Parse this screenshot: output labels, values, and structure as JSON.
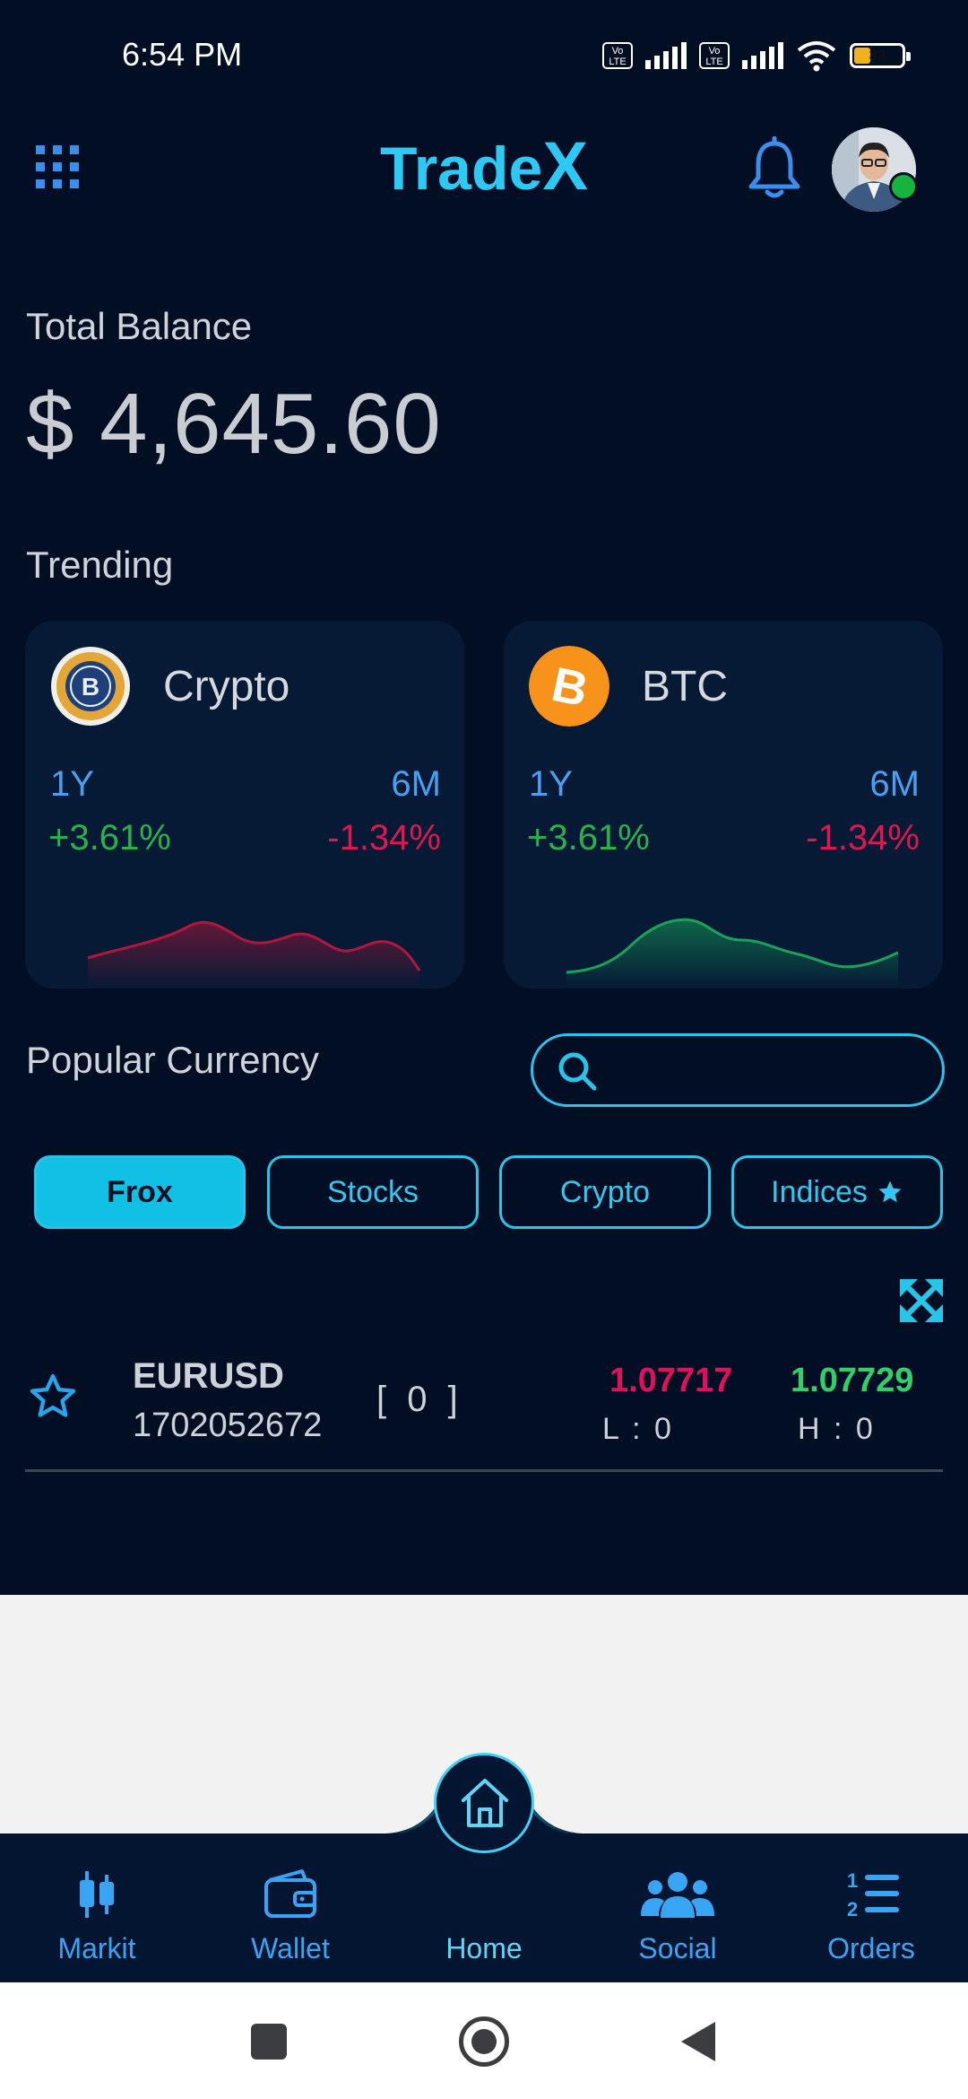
{
  "status_bar": {
    "time": "6:54 PM",
    "volte_label": "Vo LTE",
    "battery_level": "33"
  },
  "header": {
    "app_title_main": "Trade",
    "app_title_accent": "X"
  },
  "balance": {
    "label": "Total Balance",
    "value": "$ 4,645.60"
  },
  "trending": {
    "label": "Trending",
    "cards": [
      {
        "name": "Crypto",
        "icon": "bitcoin-gold-coin-icon",
        "period_1": "1Y",
        "period_2": "6M",
        "change_1": "+3.61%",
        "change_2": "-1.34%",
        "spark_color": "#b0173c"
      },
      {
        "name": "BTC",
        "icon": "bitcoin-orange-coin-icon",
        "period_1": "1Y",
        "period_2": "6M",
        "change_1": "+3.61%",
        "change_2": "-1.34%",
        "spark_color": "#17a35a"
      }
    ]
  },
  "popular": {
    "label": "Popular Currency",
    "search": {
      "value": "",
      "placeholder": ""
    },
    "filters": [
      {
        "label": "Frox",
        "active": true
      },
      {
        "label": "Stocks",
        "active": false
      },
      {
        "label": "Crypto",
        "active": false
      },
      {
        "label": "Indices",
        "active": false,
        "icon": "star-icon"
      }
    ]
  },
  "quotes": [
    {
      "symbol": "EURUSD",
      "id": "1702052672",
      "count": "[ 0 ]",
      "low_price": "1.07717",
      "high_price": "1.07729",
      "low_label": "L : 0",
      "high_label": "H : 0"
    }
  ],
  "bottom_nav": [
    {
      "label": "Markit",
      "icon": "candlestick-icon"
    },
    {
      "label": "Wallet",
      "icon": "wallet-icon"
    },
    {
      "label": "Home",
      "icon": "home-icon",
      "active": true
    },
    {
      "label": "Social",
      "icon": "people-icon"
    },
    {
      "label": "Orders",
      "icon": "numbered-list-icon"
    }
  ],
  "colors": {
    "background": "#020e24",
    "accent": "#27c5ea",
    "positive": "#27b34b",
    "negative": "#e11650"
  }
}
